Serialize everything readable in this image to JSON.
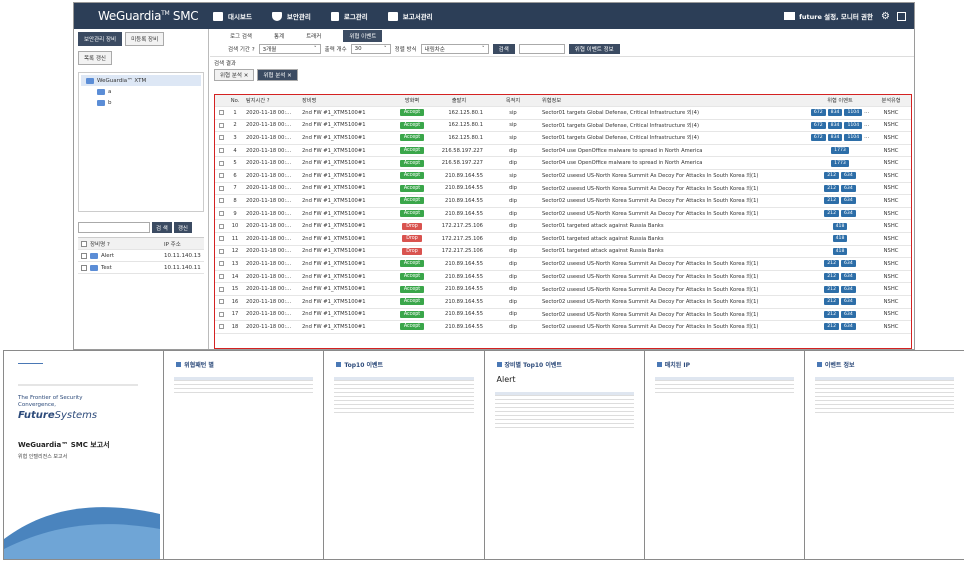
{
  "app": {
    "logo": "WeGuardia",
    "logo_tm": "TM",
    "logo_suffix": "SMC"
  },
  "nav": [
    {
      "label": "대시보드",
      "icon": "monitor-icon"
    },
    {
      "label": "보안관리",
      "icon": "shield-icon"
    },
    {
      "label": "로그관리",
      "icon": "log-icon"
    },
    {
      "label": "보고서관리",
      "icon": "report-icon"
    }
  ],
  "user": {
    "text": "future 설정, 모니터 권한",
    "icon": "mail-icon"
  },
  "left": {
    "tabs": [
      "보안관리 장비",
      "미등록 장비"
    ],
    "refresh": "목록 갱신",
    "tree": [
      {
        "label": "WeGuardia™ XTM",
        "level": 0
      },
      {
        "label": "a",
        "level": 1
      },
      {
        "label": "b",
        "level": 1
      }
    ],
    "search_btn": "검 색",
    "reset_btn": "갱신",
    "device_headers": [
      "장비명 ?",
      "IP 주소"
    ],
    "devices": [
      {
        "name": "Alert",
        "ip": "10.11.140.13"
      },
      {
        "name": "Test",
        "ip": "10.11.140.11"
      }
    ]
  },
  "right": {
    "tabs": [
      "로그 검색",
      "통계",
      "트래커",
      "위협 이벤트"
    ],
    "filter": {
      "period_label": "검색 기간 ?",
      "period": "3개월",
      "count_label": "출력 개수",
      "count": "30",
      "sort_label": "정렬 방식",
      "sort": "내림차순",
      "search": "검색",
      "info": "위협 이벤트 정보"
    },
    "result_label": "검색 결과",
    "subtabs": [
      "위협 분석",
      "위협 분석"
    ],
    "headers": [
      "No.",
      "탐지시간 ?",
      "장비명",
      "방화벽",
      "출발지",
      "목적지",
      "위협정보",
      "위협 이벤트",
      "분석유형"
    ],
    "rows": [
      {
        "no": "1",
        "time": "2020-11-18 00:...",
        "dev": "2nd FW #1_XTM5100#1",
        "act": "Accept",
        "src": "162.125.80.1",
        "dst": "sip",
        "info": "Sector01 targets Global Defense, Critical Infrastructure 외(4)",
        "evt": [
          "672",
          "834",
          "1104",
          "..."
        ],
        "ans": "NSHC"
      },
      {
        "no": "2",
        "time": "2020-11-18 00:...",
        "dev": "2nd FW #1_XTM5100#1",
        "act": "Accept",
        "src": "162.125.80.1",
        "dst": "sip",
        "info": "Sector01 targets Global Defense, Critical Infrastructure 외(4)",
        "evt": [
          "672",
          "834",
          "1104",
          "..."
        ],
        "ans": "NSHC"
      },
      {
        "no": "3",
        "time": "2020-11-18 00:...",
        "dev": "2nd FW #1_XTM5100#1",
        "act": "Accept",
        "src": "162.125.80.1",
        "dst": "sip",
        "info": "Sector01 targets Global Defense, Critical Infrastructure 외(4)",
        "evt": [
          "672",
          "834",
          "1104",
          "..."
        ],
        "ans": "NSHC"
      },
      {
        "no": "4",
        "time": "2020-11-18 00:...",
        "dev": "2nd FW #1_XTM5100#1",
        "act": "Accept",
        "src": "216.58.197.227",
        "dst": "dip",
        "info": "Sector04 use OpenOffice malware to spread in North America",
        "evt": [
          "1773"
        ],
        "ans": "NSHC"
      },
      {
        "no": "5",
        "time": "2020-11-18 00:...",
        "dev": "2nd FW #1_XTM5100#1",
        "act": "Accept",
        "src": "216.58.197.227",
        "dst": "dip",
        "info": "Sector04 use OpenOffice malware to spread in North America",
        "evt": [
          "1773"
        ],
        "ans": "NSHC"
      },
      {
        "no": "6",
        "time": "2020-11-18 00:...",
        "dev": "2nd FW #1_XTM5100#1",
        "act": "Accept",
        "src": "210.89.164.55",
        "dst": "sip",
        "info": "Sector02 useesd US-North Korea Summit As Decoy For Attacks In South Korea 외(1)",
        "evt": [
          "212",
          "634"
        ],
        "ans": "NSHC"
      },
      {
        "no": "7",
        "time": "2020-11-18 00:...",
        "dev": "2nd FW #1_XTM5100#1",
        "act": "Accept",
        "src": "210.89.164.55",
        "dst": "dip",
        "info": "Sector02 useesd US-North Korea Summit As Decoy For Attacks In South Korea 외(1)",
        "evt": [
          "212",
          "634"
        ],
        "ans": "NSHC"
      },
      {
        "no": "8",
        "time": "2020-11-18 00:...",
        "dev": "2nd FW #1_XTM5100#1",
        "act": "Accept",
        "src": "210.89.164.55",
        "dst": "dip",
        "info": "Sector02 useesd US-North Korea Summit As Decoy For Attacks In South Korea 외(1)",
        "evt": [
          "212",
          "634"
        ],
        "ans": "NSHC"
      },
      {
        "no": "9",
        "time": "2020-11-18 00:...",
        "dev": "2nd FW #1_XTM5100#1",
        "act": "Accept",
        "src": "210.89.164.55",
        "dst": "dip",
        "info": "Sector02 useesd US-North Korea Summit As Decoy For Attacks In South Korea 외(1)",
        "evt": [
          "212",
          "634"
        ],
        "ans": "NSHC"
      },
      {
        "no": "10",
        "time": "2020-11-18 00:...",
        "dev": "2nd FW #1_XTM5100#1",
        "act": "Drop",
        "src": "172.217.25.106",
        "dst": "dip",
        "info": "Sector01 targeted attack against Russia Banks",
        "evt": [
          "418"
        ],
        "ans": "NSHC"
      },
      {
        "no": "11",
        "time": "2020-11-18 00:...",
        "dev": "2nd FW #1_XTM5100#1",
        "act": "Drop",
        "src": "172.217.25.106",
        "dst": "dip",
        "info": "Sector01 targeted attack against Russia Banks",
        "evt": [
          "418"
        ],
        "ans": "NSHC"
      },
      {
        "no": "12",
        "time": "2020-11-18 00:...",
        "dev": "2nd FW #1_XTM5100#1",
        "act": "Drop",
        "src": "172.217.25.106",
        "dst": "dip",
        "info": "Sector01 targeted attack against Russia Banks",
        "evt": [
          "418"
        ],
        "ans": "NSHC"
      },
      {
        "no": "13",
        "time": "2020-11-18 00:...",
        "dev": "2nd FW #1_XTM5100#1",
        "act": "Accept",
        "src": "210.89.164.55",
        "dst": "dip",
        "info": "Sector02 useesd US-North Korea Summit As Decoy For Attacks In South Korea 외(1)",
        "evt": [
          "212",
          "634"
        ],
        "ans": "NSHC"
      },
      {
        "no": "14",
        "time": "2020-11-18 00:...",
        "dev": "2nd FW #1_XTM5100#1",
        "act": "Accept",
        "src": "210.89.164.55",
        "dst": "dip",
        "info": "Sector02 useesd US-North Korea Summit As Decoy For Attacks In South Korea 외(1)",
        "evt": [
          "212",
          "634"
        ],
        "ans": "NSHC"
      },
      {
        "no": "15",
        "time": "2020-11-18 00:...",
        "dev": "2nd FW #1_XTM5100#1",
        "act": "Accept",
        "src": "210.89.164.55",
        "dst": "dip",
        "info": "Sector02 useesd US-North Korea Summit As Decoy For Attacks In South Korea 외(1)",
        "evt": [
          "212",
          "634"
        ],
        "ans": "NSHC"
      },
      {
        "no": "16",
        "time": "2020-11-18 00:...",
        "dev": "2nd FW #1_XTM5100#1",
        "act": "Accept",
        "src": "210.89.164.55",
        "dst": "dip",
        "info": "Sector02 useesd US-North Korea Summit As Decoy For Attacks In South Korea 외(1)",
        "evt": [
          "212",
          "634"
        ],
        "ans": "NSHC"
      },
      {
        "no": "17",
        "time": "2020-11-18 00:...",
        "dev": "2nd FW #1_XTM5100#1",
        "act": "Accept",
        "src": "210.89.164.55",
        "dst": "dip",
        "info": "Sector02 useesd US-North Korea Summit As Decoy For Attacks In South Korea 외(1)",
        "evt": [
          "212",
          "634"
        ],
        "ans": "NSHC"
      },
      {
        "no": "18",
        "time": "2020-11-18 00:...",
        "dev": "2nd FW #1_XTM5100#1",
        "act": "Accept",
        "src": "210.89.164.55",
        "dst": "dip",
        "info": "Sector02 useesd US-North Korea Summit As Decoy For Attacks In South Korea 외(1)",
        "evt": [
          "212",
          "634"
        ],
        "ans": "NSHC"
      }
    ]
  },
  "reports": {
    "cover": {
      "frontier": "The Frontier of Security Convergence,",
      "brand_a": "Future",
      "brand_b": "Systems",
      "title": "WeGuardia™ SMC 보고서",
      "subtitle": "위협 인텔리전스 보고서"
    },
    "pages": [
      {
        "title": "위협패턴 별",
        "alert": "",
        "rows": 3
      },
      {
        "title": "Top10 이벤트",
        "alert": "",
        "rows": 8
      },
      {
        "title": "장비별 Top10 이벤트",
        "alert": "Alert",
        "rows": 8
      },
      {
        "title": "매치된 IP",
        "alert": "",
        "rows": 3
      },
      {
        "title": "이벤트 정보",
        "alert": "",
        "rows": 8
      }
    ]
  }
}
